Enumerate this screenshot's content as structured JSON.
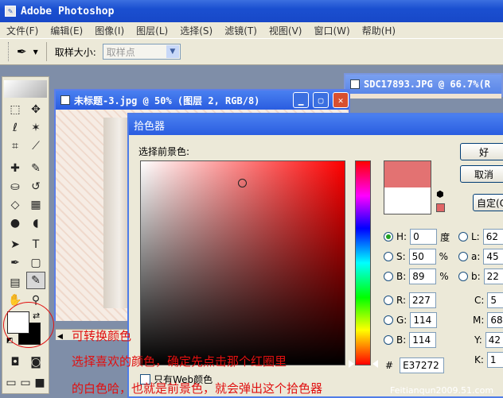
{
  "app": {
    "title": "Adobe Photoshop"
  },
  "menu": [
    "文件(F)",
    "编辑(E)",
    "图像(I)",
    "图层(L)",
    "选择(S)",
    "滤镜(T)",
    "视图(V)",
    "窗口(W)",
    "帮助(H)"
  ],
  "options": {
    "sample_size_label": "取样大小:",
    "sample_size_value": "取样点"
  },
  "doc_back": {
    "title": "SDC17893.JPG @ 66.7%(R"
  },
  "doc_front": {
    "title": "未标题-3.jpg @ 50% (图层 2, RGB/8)"
  },
  "picker": {
    "title": "拾色器",
    "prompt": "选择前景色:",
    "ok": "好",
    "cancel": "取消",
    "custom": "自定(C",
    "web_only": "只有Web颜色",
    "fields": {
      "H": {
        "label": "H:",
        "value": "0",
        "unit": "度"
      },
      "S": {
        "label": "S:",
        "value": "50",
        "unit": "%"
      },
      "B": {
        "label": "B:",
        "value": "89",
        "unit": "%"
      },
      "R": {
        "label": "R:",
        "value": "227"
      },
      "G": {
        "label": "G:",
        "value": "114"
      },
      "Bl": {
        "label": "B:",
        "value": "114"
      },
      "L": {
        "label": "L:",
        "value": "62"
      },
      "a": {
        "label": "a:",
        "value": "45"
      },
      "b": {
        "label": "b:",
        "value": "22"
      },
      "C": {
        "label": "C:",
        "value": "5"
      },
      "M": {
        "label": "M:",
        "value": "68"
      },
      "Y": {
        "label": "Y:",
        "value": "42"
      },
      "K": {
        "label": "K:",
        "value": "1"
      }
    },
    "hex_label": "#",
    "hex": "E37272",
    "new_color": "#e37272",
    "old_color": "#ffffff"
  },
  "annotations": {
    "line1": "可转换颜色",
    "line2": "选择喜欢的颜色，确定先点击那个红圈里",
    "line3": "的白色哈，也就是前景色，就会弹出这个拾色器"
  },
  "watermark": "Feitianqun2009.51.com"
}
